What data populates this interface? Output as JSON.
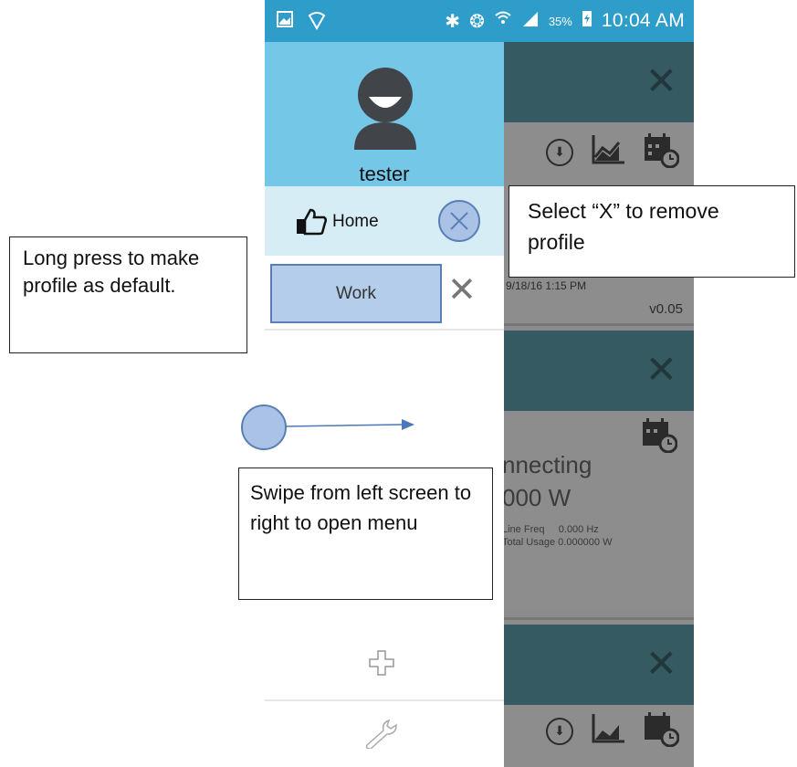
{
  "status_bar": {
    "battery_percent": "35%",
    "time": "10:04 AM"
  },
  "drawer": {
    "username": "tester",
    "profiles": [
      {
        "label": "Home"
      },
      {
        "label": "Work"
      }
    ]
  },
  "background_cards": {
    "card1": {
      "date": "9/18/16 1:15 PM",
      "version": "v0.05"
    },
    "card2": {
      "status": "nnecting",
      "power": "000 W",
      "line_freq_label": "Line Freq",
      "line_freq_value": "0.000 Hz",
      "total_usage_label": "Total Usage",
      "total_usage_value": "0.000000 W"
    }
  },
  "annotations": {
    "long_press": "Long press to make profile as default.",
    "remove": "Select “X” to remove profile",
    "swipe": "Swipe from left screen to right to open menu"
  },
  "colors": {
    "status_bar": "#2e9dc9",
    "drawer_header": "#74c7e6",
    "home_row": "#d6edf6",
    "card_header": "#355a62",
    "highlight": "#a9c2e6"
  }
}
